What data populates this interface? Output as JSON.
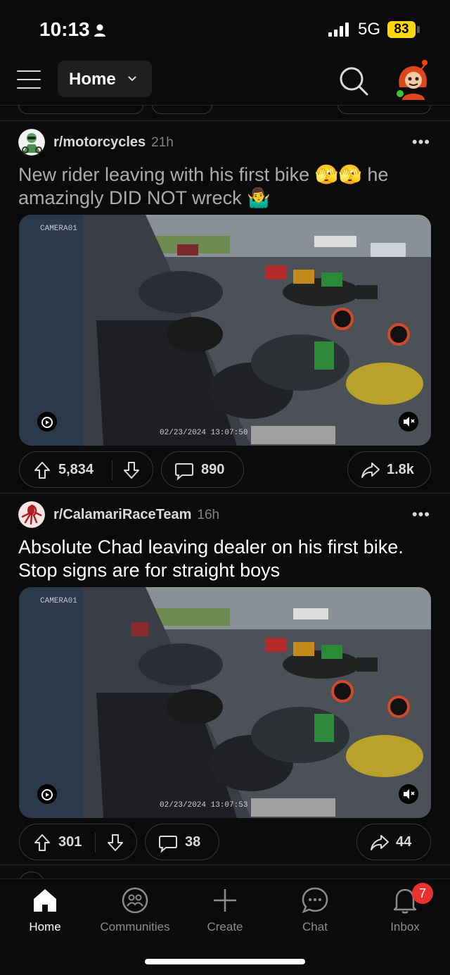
{
  "status": {
    "time": "10:13",
    "network": "5G",
    "battery": "83"
  },
  "header": {
    "feed_label": "Home"
  },
  "posts": [
    {
      "subreddit": "r/motorcycles",
      "age": "21h",
      "title": "New rider leaving with his first bike 🫣🫣 he amazingly DID NOT wreck 🤷‍♂️",
      "media_timestamp": "02/23/2024  13:07:50",
      "media_camera": "CAMERA01",
      "upvotes": "5,834",
      "comments": "890",
      "shares": "1.8k"
    },
    {
      "subreddit": "r/CalamariRaceTeam",
      "age": "16h",
      "title": "Absolute Chad leaving dealer on his first bike. Stop signs are for straight boys",
      "media_timestamp": "02/23/2024  13:07:53",
      "media_camera": "CAMERA01",
      "upvotes": "301",
      "comments": "38",
      "shares": "44"
    }
  ],
  "nav": {
    "home": "Home",
    "communities": "Communities",
    "create": "Create",
    "chat": "Chat",
    "inbox": "Inbox",
    "inbox_badge": "7"
  },
  "colors": {
    "background": "#0b0b0b",
    "accent": "#ff4500",
    "badge": "#e8322d",
    "battery": "#ffd60a"
  }
}
